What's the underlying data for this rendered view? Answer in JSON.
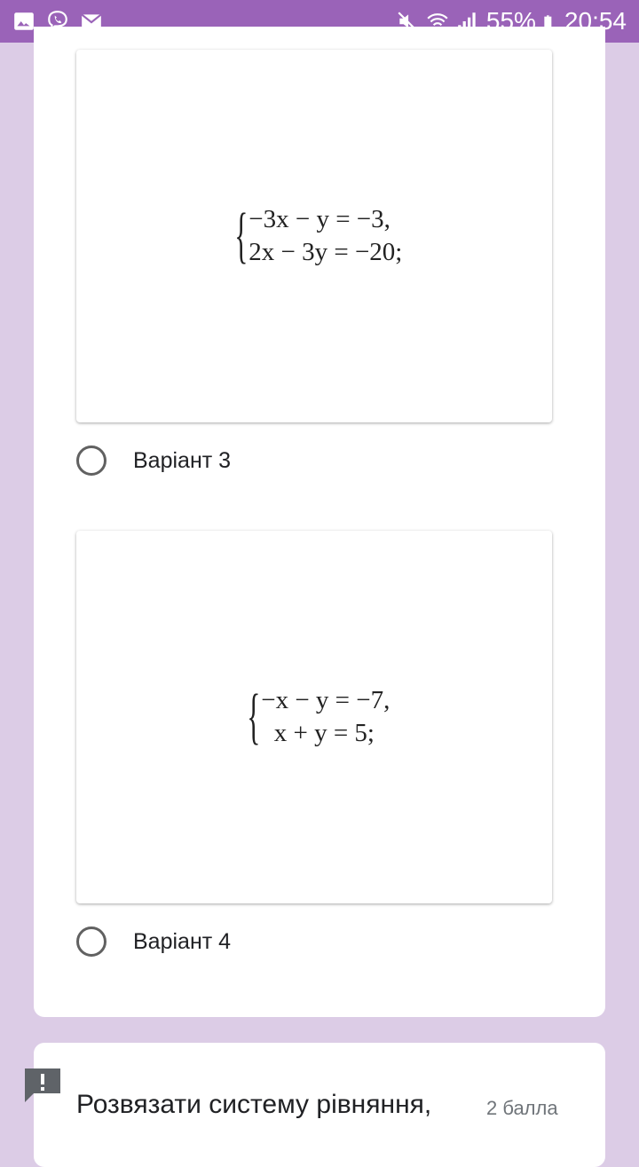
{
  "status_bar": {
    "battery": "55%",
    "time": "20:54",
    "icons": [
      "gallery-icon",
      "viber-icon",
      "mail-icon",
      "mute-icon",
      "wifi-icon",
      "signal-icon",
      "battery-icon"
    ]
  },
  "options": [
    {
      "equations": [
        "−3x − y = −3,",
        "2x − 3y = −20;"
      ],
      "label": "Варіант 3"
    },
    {
      "equations": [
        "−x − y = −7,",
        "  x + y = 5;"
      ],
      "label": "Варіант 4"
    }
  ],
  "next_question": {
    "title": "Розвязати систему рівняння,",
    "points": "2 балла"
  },
  "colors": {
    "status_bar": "#9a63b8",
    "background": "#dccce6",
    "radio": "#616161",
    "alert_flag": "#5f6368"
  }
}
